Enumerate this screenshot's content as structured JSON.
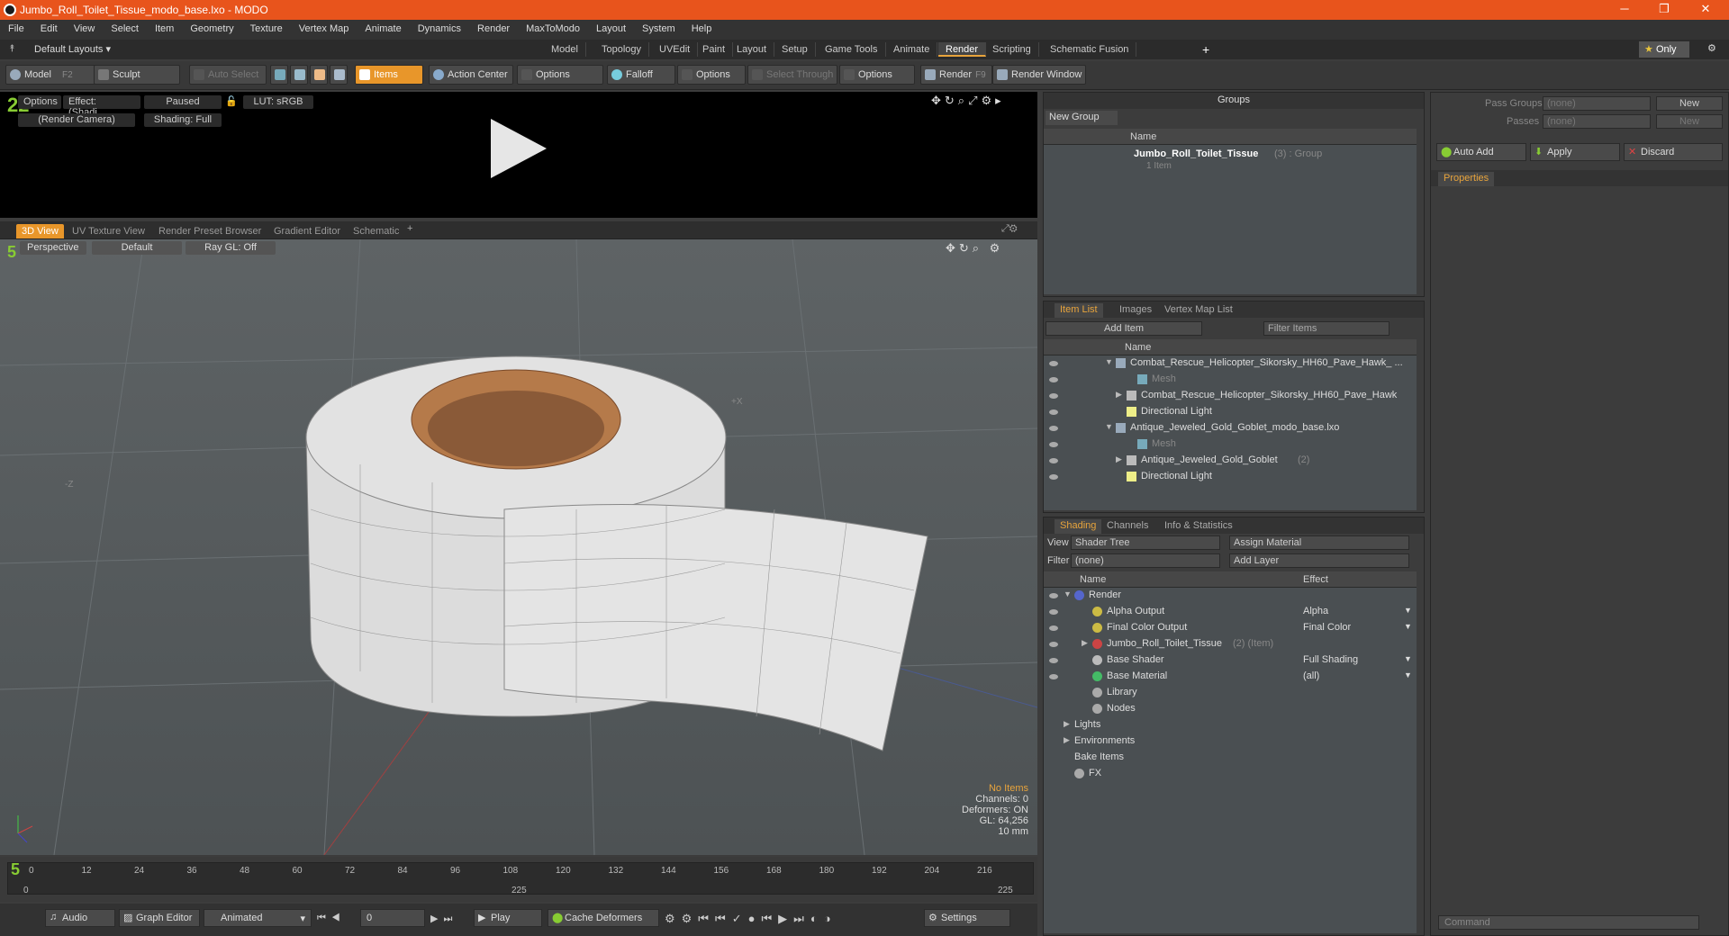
{
  "window": {
    "title": "Jumbo_Roll_Toilet_Tissue_modo_base.lxo - MODO",
    "min": "─",
    "restore": "❐",
    "close": "✕"
  },
  "menu": [
    "File",
    "Edit",
    "View",
    "Select",
    "Item",
    "Geometry",
    "Texture",
    "Vertex Map",
    "Animate",
    "Dynamics",
    "Render",
    "MaxToModo",
    "Layout",
    "System",
    "Help"
  ],
  "layouts": {
    "current": "Default Layouts ▾",
    "tabs": [
      "Model",
      "Topology",
      "UVEdit",
      "Paint",
      "Layout",
      "Setup",
      "Game Tools",
      "Animate",
      "Render",
      "Scripting",
      "Schematic Fusion"
    ],
    "active": "Render",
    "add": "+",
    "only": "Only",
    "star": "★"
  },
  "toolbar": {
    "model": "Model",
    "model_key": "F2",
    "sculpt": "Sculpt",
    "auto_select": "Auto Select",
    "items": "Items",
    "action_center": "Action Center",
    "options1": "Options",
    "falloff": "Falloff",
    "options2": "Options",
    "select_through": "Select Through",
    "options3": "Options",
    "render": "Render",
    "render_key": "F9",
    "render_window": "Render Window"
  },
  "preview": {
    "options": "Options",
    "effect": "Effect: (Shadi...",
    "paused": "Paused",
    "lut": "LUT: sRGB",
    "camera": "(Render Camera)",
    "shading": "Shading: Full"
  },
  "viewtabs": [
    "3D View",
    "UV Texture View",
    "Render Preset Browser",
    "Gradient Editor",
    "Schematic"
  ],
  "viewport": {
    "perspective": "Perspective",
    "default": "Default",
    "raygl": "Ray GL: Off",
    "axis_x": "+X",
    "axis_z": "-Z",
    "info": [
      "No Items",
      "Channels: 0",
      "Deformers: ON",
      "GL: 64,256",
      "10 mm"
    ]
  },
  "timeline": {
    "ticks": [
      "0",
      "12",
      "24",
      "36",
      "48",
      "60",
      "72",
      "84",
      "96",
      "108",
      "120",
      "132",
      "144",
      "156",
      "168",
      "180",
      "192",
      "204",
      "216"
    ],
    "start": "0",
    "mid": "225",
    "end": "225"
  },
  "bottom": {
    "audio": "Audio",
    "graph": "Graph Editor",
    "animated": "Animated",
    "frame": "0",
    "play": "Play",
    "cache": "Cache Deformers",
    "settings": "Settings"
  },
  "groups": {
    "title": "Groups",
    "new_group": "New Group",
    "col_name": "Name",
    "item_name": "Jumbo_Roll_Toilet_Tissue",
    "item_meta": "(3) : Group",
    "item_sub": "1 Item"
  },
  "passes": {
    "pass_groups": "Pass Groups",
    "passes": "Passes",
    "none": "(none)",
    "new": "New",
    "auto_add": "Auto Add",
    "apply": "Apply",
    "discard": "Discard",
    "properties": "Properties"
  },
  "itemlist": {
    "tabs": [
      "Item List",
      "Images",
      "Vertex Map List"
    ],
    "add_item": "Add Item",
    "filter": "Filter Items",
    "col_name": "Name",
    "rows": [
      {
        "t": "Combat_Rescue_Helicopter_Sikorsky_HH60_Pave_Hawk_ ...",
        "ind": 0,
        "k": "scene"
      },
      {
        "t": "Mesh",
        "ind": 2,
        "k": "mesh"
      },
      {
        "t": "Combat_Rescue_Helicopter_Sikorsky_HH60_Pave_Hawk",
        "ind": 1,
        "k": "group"
      },
      {
        "t": "Directional Light",
        "ind": 1,
        "k": "light"
      },
      {
        "t": "Antique_Jeweled_Gold_Goblet_modo_base.lxo",
        "ind": 0,
        "k": "scene"
      },
      {
        "t": "Mesh",
        "ind": 2,
        "k": "mesh"
      },
      {
        "t": "Antique_Jeweled_Gold_Goblet",
        "ind": 1,
        "k": "group",
        "extra": "(2)"
      },
      {
        "t": "Directional Light",
        "ind": 1,
        "k": "light"
      }
    ]
  },
  "shading": {
    "tabs": [
      "Shading",
      "Channels",
      "Info & Statistics"
    ],
    "view_label": "View",
    "view": "Shader Tree",
    "assign": "Assign Material",
    "filter_label": "Filter",
    "filter": "(none)",
    "add_layer": "Add Layer",
    "col_name": "Name",
    "col_effect": "Effect",
    "rows": [
      {
        "t": "Render",
        "e": "",
        "ind": 0
      },
      {
        "t": "Alpha Output",
        "e": "Alpha",
        "ind": 1
      },
      {
        "t": "Final Color Output",
        "e": "Final Color",
        "ind": 1
      },
      {
        "t": "Jumbo_Roll_Toilet_Tissue",
        "e": "",
        "ind": 1,
        "extra": "(2) (Item)"
      },
      {
        "t": "Base Shader",
        "e": "Full Shading",
        "ind": 1
      },
      {
        "t": "Base Material",
        "e": "(all)",
        "ind": 1
      },
      {
        "t": "Library",
        "e": "",
        "ind": 1
      },
      {
        "t": "Nodes",
        "e": "",
        "ind": 1
      },
      {
        "t": "Lights",
        "e": "",
        "ind": 0
      },
      {
        "t": "Environments",
        "e": "",
        "ind": 0
      },
      {
        "t": "Bake Items",
        "e": "",
        "ind": 0
      },
      {
        "t": "FX",
        "e": "",
        "ind": 0
      }
    ]
  },
  "command": {
    "placeholder": "Command"
  },
  "colors": {
    "accent": "#e8962a",
    "title": "#e8541c"
  }
}
